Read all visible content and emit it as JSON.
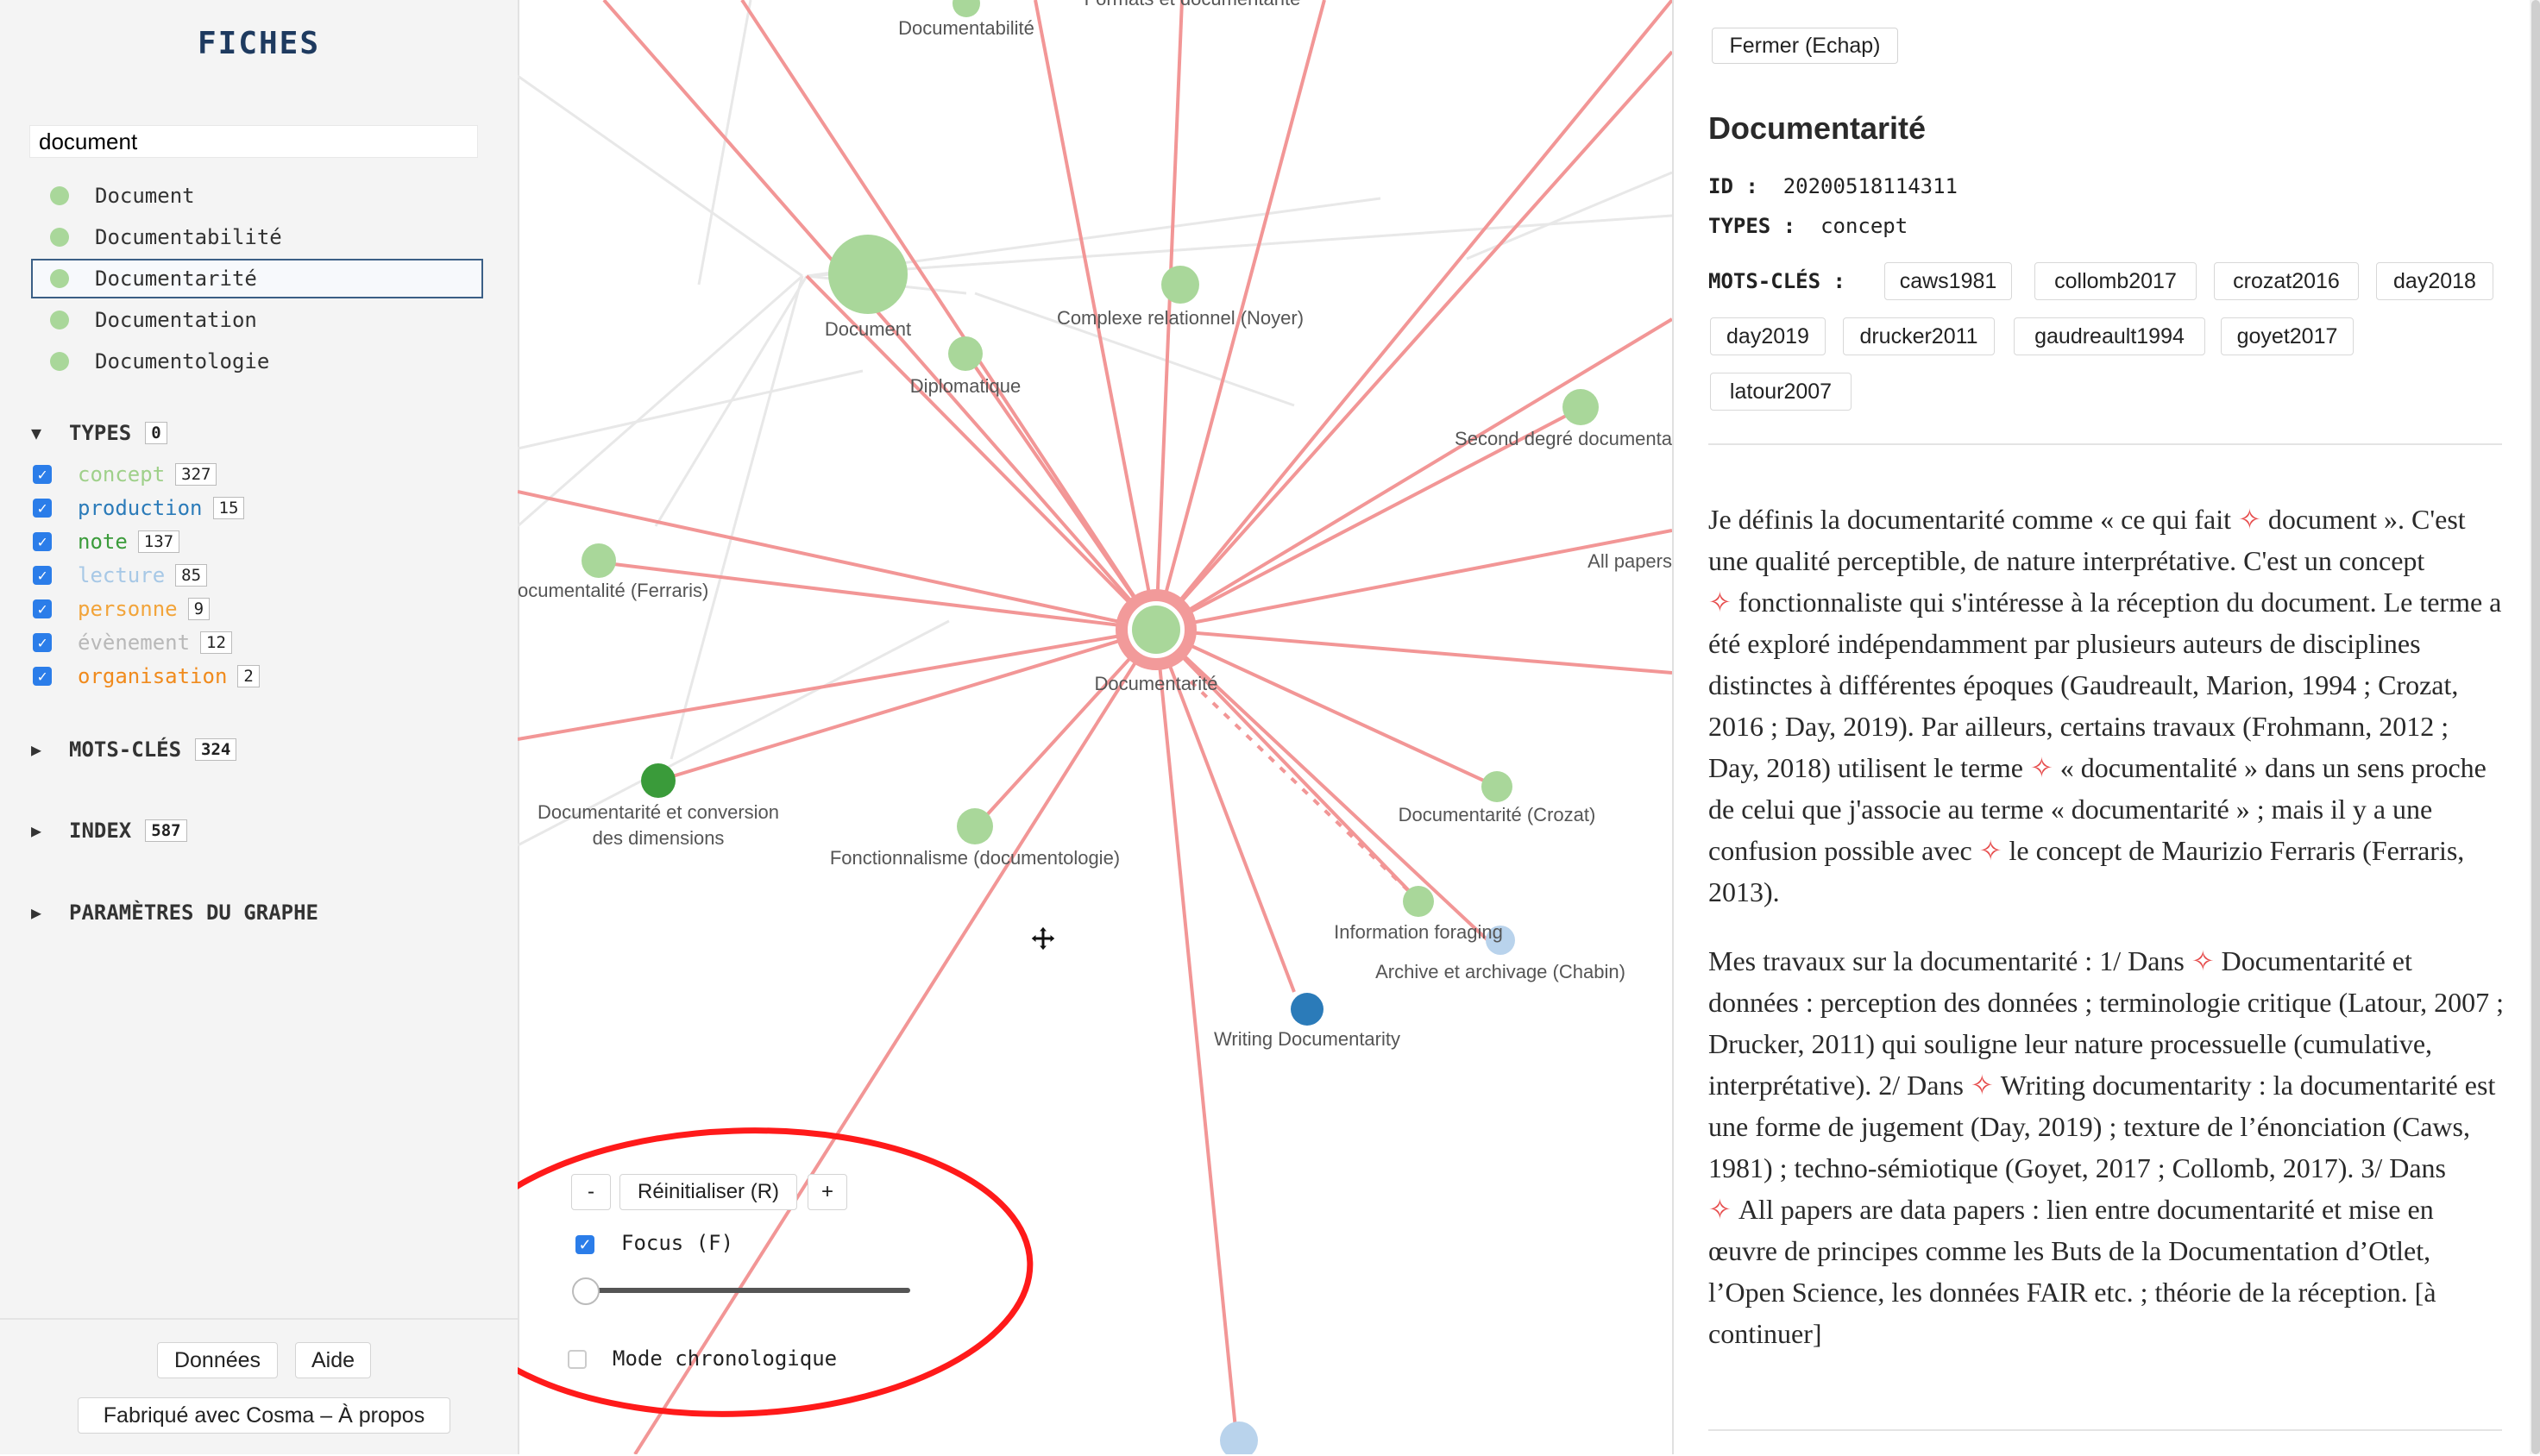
{
  "sidebar": {
    "title": "FICHES",
    "search_value": "document",
    "results": [
      "Document",
      "Documentabilité",
      "Documentarité",
      "Documentation",
      "Documentologie"
    ],
    "selected_index": 2,
    "types_label": "TYPES",
    "types_count": "0",
    "types": [
      {
        "label": "concept",
        "count": "327",
        "color": "#9fd08a"
      },
      {
        "label": "production",
        "count": "15",
        "color": "#2b7bb9"
      },
      {
        "label": "note",
        "count": "137",
        "color": "#3a9b3a"
      },
      {
        "label": "lecture",
        "count": "85",
        "color": "#a7c8e6"
      },
      {
        "label": "personne",
        "count": "9",
        "color": "#f2a43a"
      },
      {
        "label": "évènement",
        "count": "12",
        "color": "#b8b8b8"
      },
      {
        "label": "organisation",
        "count": "2",
        "color": "#f08a1c"
      }
    ],
    "keywords_label": "MOTS-CLÉS",
    "keywords_count": "324",
    "index_label": "INDEX",
    "index_count": "587",
    "graph_params_label": "PARAMÈTRES DU GRAPHE",
    "footer": {
      "data_button": "Données",
      "help_button": "Aide",
      "credits": "Fabriqué avec Cosma – À propos"
    }
  },
  "graph": {
    "labels": {
      "documentabilite": "Documentabilité",
      "formats": "Formats et documentarité",
      "document": "Document",
      "complexe": "Complexe relationnel (Noyer)",
      "diplomatique": "Diplomatique",
      "second_degre": "Second degré documenta",
      "all_papers": "All papers",
      "ferraris": "ocumentalité (Ferraris)",
      "documentarite": "Documentarité",
      "conversion_1": "Documentarité et conversion",
      "conversion_2": "des dimensions",
      "fonctionnalisme": "Fonctionnalisme (documentologie)",
      "crozat": "Documentarité (Crozat)",
      "foraging": "Information foraging",
      "archive": "Archive et archivage (Chabin)",
      "writing": "Writing Documentarity"
    },
    "controls": {
      "zoom_out": "-",
      "reset": "Réinitialiser (R)",
      "zoom_in": "+",
      "focus_label": "Focus (F)",
      "focus_checked": true,
      "chrono_label": "Mode chronologique",
      "chrono_checked": false
    },
    "colors": {
      "edge_highlight": "#f08a8a",
      "edge_faint": "#e6e6e6",
      "concept": "#a9d79a",
      "selected_ring": "#f29a9a",
      "production": "#2b7bb9",
      "note": "#3a9b3a",
      "lecture": "#b9d3ec",
      "annotation_circle": "#ff1a1a"
    }
  },
  "record": {
    "close_button": "Fermer (Echap)",
    "title": "Documentarité",
    "id_label": "ID :",
    "id_value": "20200518114311",
    "types_label": "TYPES :",
    "types_value": "concept",
    "keywords_label": "MOTS-CLÉS :",
    "keywords": [
      "caws1981",
      "collomb2017",
      "crozat2016",
      "day2018",
      "day2019",
      "drucker2011",
      "gaudreault1994",
      "goyet2017",
      "latour2007"
    ],
    "link_marker": "✧",
    "p1": {
      "a": "Je définis la documentarité comme « ce qui fait ",
      "link1": "document",
      "b": " ». C'est une qualité perceptible, de nature interprétative. C'est un concept ",
      "link2": "fonctionnaliste",
      "c": " qui s'intéresse à la réception du document. Le terme a été exploré indépendamment par plusieurs auteurs de disciplines distinctes à différentes époques (Gaudreault, Marion, 1994 ; Crozat, 2016 ; Day, 2019). Par ailleurs, certains travaux (Frohmann, 2012 ; Day, 2018) utilisent le terme ",
      "link3": "« documentalité »",
      "d": " dans un sens proche de celui que j'associe au terme « documentarité » ; mais il y a une confusion possible avec ",
      "link4": "le concept de Maurizio Ferraris",
      "e": " (Ferraris, 2013)."
    },
    "p2": {
      "a": "Mes travaux sur la documentarité : 1/ Dans ",
      "link1": "Documentarité et données : perception des données ; terminologie critique",
      "b": " (Latour, 2007 ; Drucker, 2011) qui souligne leur nature processuelle (cumulative, interprétative). 2/ Dans ",
      "link2": "Writing documentarity",
      "c": " : la documentarité est une forme de jugement (Day, 2019) ; texture de l’énonciation (Caws, 1981) ; techno-sémiotique (Goyet, 2017 ; Collomb, 2017). 3/ Dans ",
      "link3": "All papers are data papers",
      "d": " : lien entre documentarité et mise en œuvre de principes comme les Buts de la Documentation d’Otlet, l’Open Science, les données FAIR etc. ; théorie de la réception. [à continuer]"
    }
  }
}
